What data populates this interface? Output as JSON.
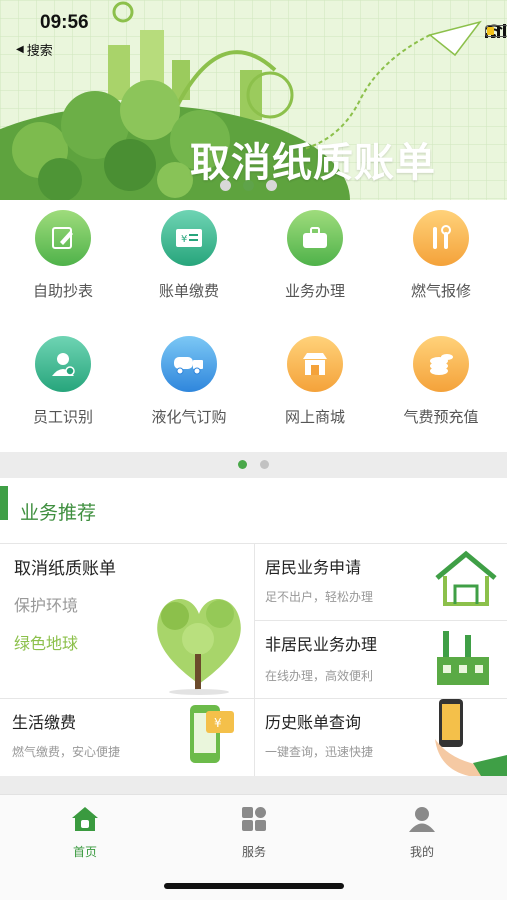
{
  "status": {
    "time": "09:56",
    "back_label": "搜索"
  },
  "banner": {
    "title": "取消纸质账单",
    "dot_count": 3,
    "active_dot": 1
  },
  "colors": {
    "brand_green": "#3f9f46",
    "tab_active": "#3a9a3f"
  },
  "services": [
    {
      "label": "自助抄表",
      "icon": "edit-icon",
      "color": "green"
    },
    {
      "label": "账单缴费",
      "icon": "bill-icon",
      "color": "teal"
    },
    {
      "label": "业务办理",
      "icon": "briefcase-icon",
      "color": "green"
    },
    {
      "label": "燃气报修",
      "icon": "repair-tools-icon",
      "color": "orange"
    },
    {
      "label": "员工识别",
      "icon": "staff-icon",
      "color": "teal"
    },
    {
      "label": "液化气订购",
      "icon": "truck-icon",
      "color": "blue"
    },
    {
      "label": "网上商城",
      "icon": "shop-icon",
      "color": "orange"
    },
    {
      "label": "气费预充值",
      "icon": "coins-icon",
      "color": "orange"
    }
  ],
  "grid_pager": {
    "dot_count": 2,
    "active_dot": 0
  },
  "recommend": {
    "title": "业务推荐",
    "paperless": {
      "title": "取消纸质账单",
      "line1": "保护环境",
      "line2": "绿色地球"
    },
    "living_payment": {
      "title": "生活缴费",
      "subtitle": "燃气缴费，安心便捷"
    },
    "resident": {
      "title": "居民业务申请",
      "subtitle": "足不出户，轻松办理"
    },
    "non_resident": {
      "title": "非居民业务办理",
      "subtitle": "在线办理，高效便利"
    },
    "history": {
      "title": "历史账单查询",
      "subtitle": "一键查询，迅速快捷"
    }
  },
  "tabs": [
    {
      "label": "首页",
      "icon": "home-icon",
      "active": true
    },
    {
      "label": "服务",
      "icon": "grid-icon",
      "active": false
    },
    {
      "label": "我的",
      "icon": "user-icon",
      "active": false
    }
  ]
}
